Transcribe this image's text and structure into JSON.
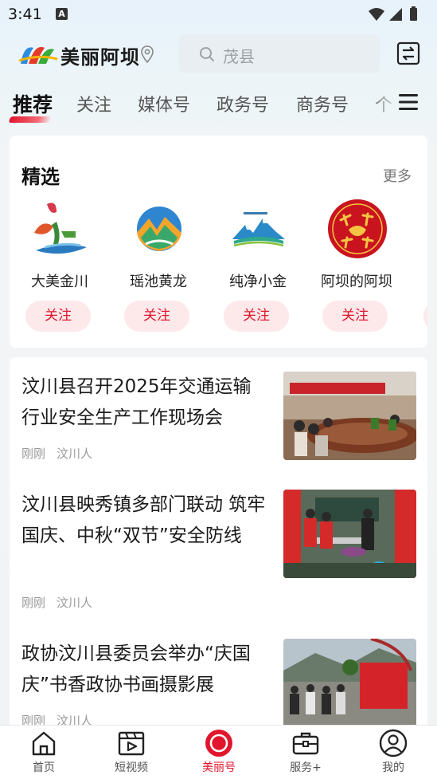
{
  "status_bar": {
    "time": "3:41",
    "notification_badge": "A"
  },
  "header": {
    "app_name": "美丽阿坝",
    "search_placeholder": "茂县"
  },
  "tabs": [
    {
      "label": "推荐",
      "active": true
    },
    {
      "label": "关注"
    },
    {
      "label": "媒体号"
    },
    {
      "label": "政务号"
    },
    {
      "label": "商务号"
    },
    {
      "label": "个"
    }
  ],
  "featured": {
    "title": "精选",
    "more_label": "更多",
    "items": [
      {
        "name": "大美金川",
        "follow_label": "关注"
      },
      {
        "name": "瑶池黄龙",
        "follow_label": "关注"
      },
      {
        "name": "纯净小金",
        "follow_label": "关注"
      },
      {
        "name": "阿坝的阿坝",
        "follow_label": "关注"
      }
    ]
  },
  "news": [
    {
      "title": "汶川县召开2025年交通运输行业安全生产工作现场会",
      "time": "刚刚",
      "source": "汶川人"
    },
    {
      "title": "汶川县映秀镇多部门联动 筑牢国庆、中秋“双节”安全防线",
      "time": "刚刚",
      "source": "汶川人"
    },
    {
      "title": "政协汶川县委员会举办“庆国庆”书香政协书画摄影展",
      "time": "刚刚",
      "source": "汶川人"
    }
  ],
  "bottom_nav": [
    {
      "label": "首页",
      "icon": "home-icon"
    },
    {
      "label": "短视频",
      "icon": "video-icon"
    },
    {
      "label": "美丽号",
      "icon": "meili-icon",
      "active": true
    },
    {
      "label": "服务+",
      "icon": "briefcase-icon"
    },
    {
      "label": "我的",
      "icon": "user-icon"
    }
  ],
  "colors": {
    "accent": "#e0162c",
    "follow_bg": "#fde8ea"
  }
}
